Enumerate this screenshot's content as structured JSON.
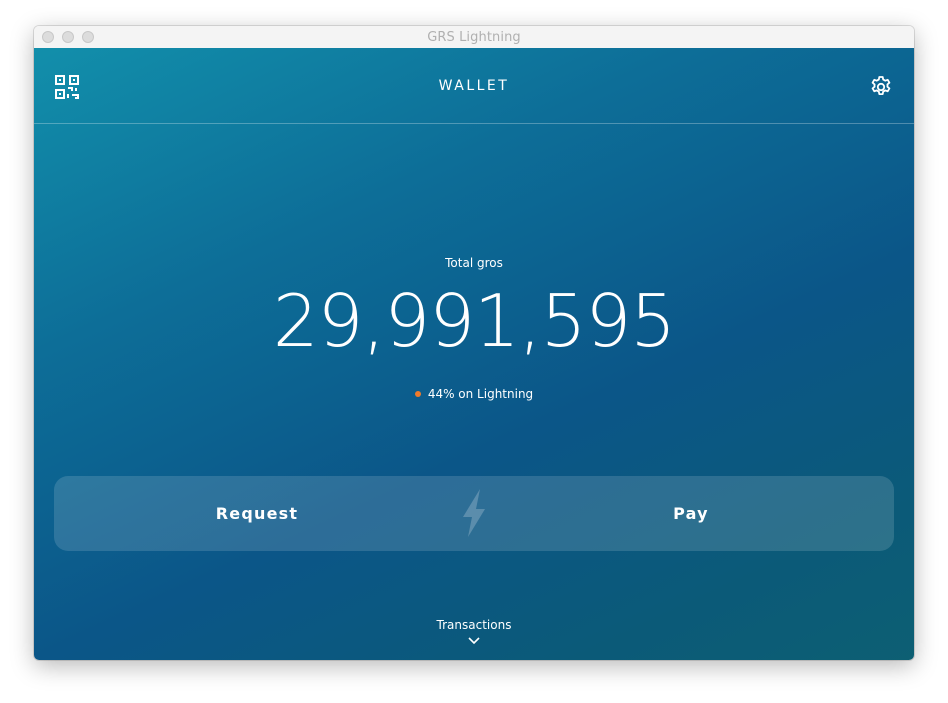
{
  "window": {
    "title": "GRS Lightning"
  },
  "header": {
    "title": "WALLET",
    "qr_icon": "qr-code-icon",
    "settings_icon": "gear-icon"
  },
  "balance": {
    "label": "Total gros",
    "amount": "29,991,595",
    "lightning_share": "44% on Lightning",
    "lightning_dot_color": "#f07a2a"
  },
  "actions": {
    "request_label": "Request",
    "pay_label": "Pay",
    "divider_icon": "lightning-bolt-icon"
  },
  "transactions": {
    "label": "Transactions",
    "toggle_icon": "chevron-down-icon"
  },
  "colors": {
    "gradient_start": "#128fab",
    "gradient_end": "#0b5688",
    "text": "#ffffff"
  }
}
